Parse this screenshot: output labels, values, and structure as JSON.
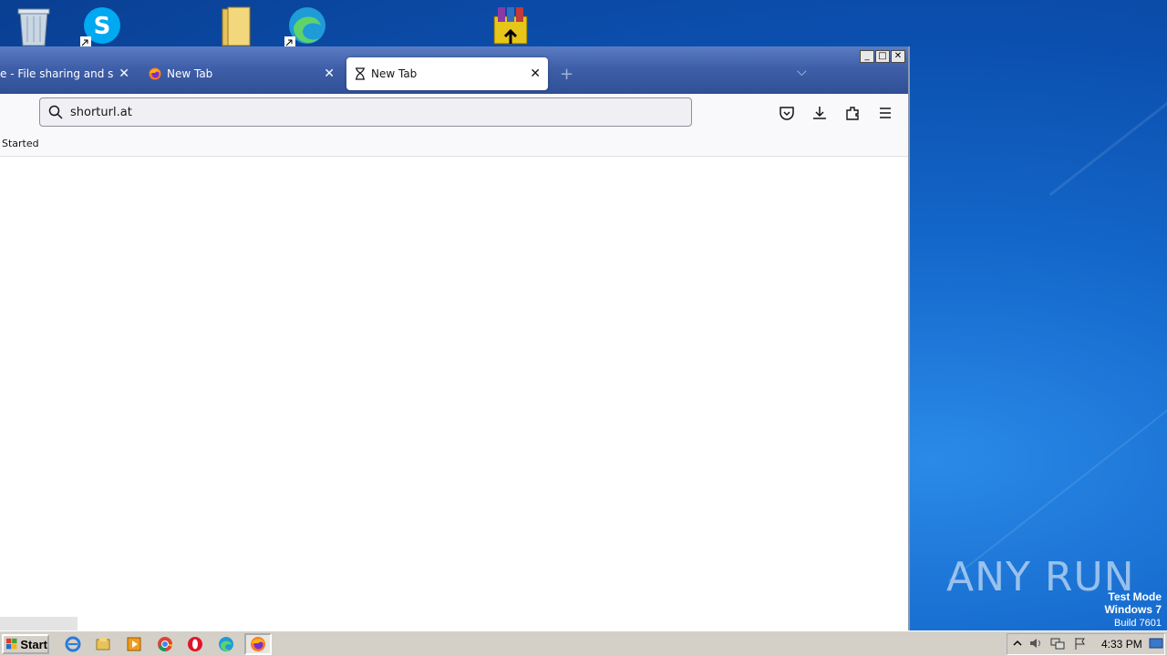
{
  "browser": {
    "tabs": [
      {
        "label": "e - File sharing and storage made simple",
        "close": "✕"
      },
      {
        "label": "New Tab",
        "close": "✕"
      },
      {
        "label": "New Tab",
        "close": "✕"
      }
    ],
    "new_tab_symbol": "+",
    "tab_list_symbol": "⌵",
    "window_buttons": {
      "minimize": "_",
      "maximize": "□",
      "close": "✕"
    },
    "url_value": "shorturl.at",
    "bookmark_label": "Started"
  },
  "watermark": {
    "logo": "ANY RUN",
    "mode": "Test Mode",
    "os": "Windows 7",
    "build": "Build 7601"
  },
  "taskbar": {
    "start_label": "Start",
    "clock": "4:33 PM"
  },
  "colors": {
    "titlebar": "#3f5fa8",
    "desktop": "#1366c9",
    "taskbar": "#d4d0c8"
  }
}
